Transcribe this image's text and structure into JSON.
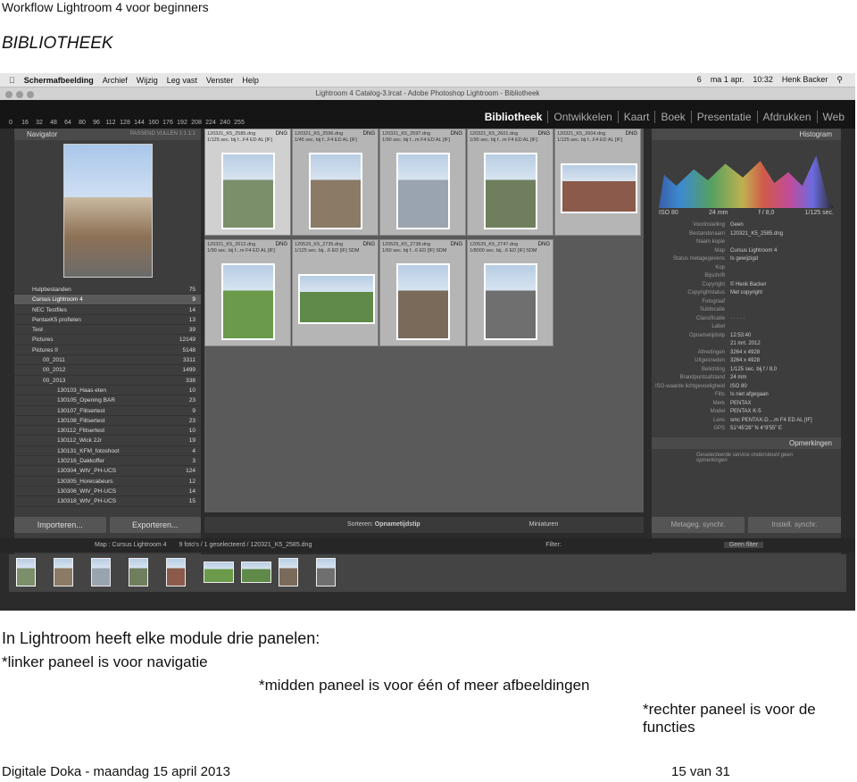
{
  "doc": {
    "title": "Workflow Lightroom 4 voor beginners",
    "section": "BIBLIOTHEEK"
  },
  "mac_menu": {
    "app": "Schermafbeelding",
    "items": [
      "Archief",
      "Wijzig",
      "Leg vast",
      "Venster",
      "Help"
    ],
    "status": [
      "6",
      "ma 1 apr.",
      "10:32",
      "Henk Backer"
    ]
  },
  "window_title": "Lightroom 4 Catalog-3.lrcat - Adobe Photoshop Lightroom - Bibliotheek",
  "thumb_sizes": [
    "0",
    "16",
    "32",
    "48",
    "64",
    "80",
    "96",
    "112",
    "128",
    "144",
    "160",
    "176",
    "192",
    "208",
    "224",
    "240",
    "255"
  ],
  "modules": [
    "Bibliotheek",
    "Ontwikkelen",
    "Kaart",
    "Boek",
    "Presentatie",
    "Afdrukken",
    "Web"
  ],
  "left_panel": {
    "navigator": "Navigator",
    "nav_opts": [
      "PASSEND",
      "VULLEN",
      "1:1",
      "1:1"
    ],
    "folders": [
      {
        "name": "Hulpbestanden",
        "count": "75"
      },
      {
        "name": "Cursus Lightroom 4",
        "count": "9"
      },
      {
        "name": "NEC Testfiles",
        "count": "14"
      },
      {
        "name": "PentaxK5 profielen",
        "count": "13"
      },
      {
        "name": "Test",
        "count": "39"
      },
      {
        "name": "Pictures",
        "count": "12149"
      },
      {
        "name": "Pictures II",
        "count": "5148"
      },
      {
        "name": "00_2011",
        "count": "3311"
      },
      {
        "name": "00_2012",
        "count": "1499"
      },
      {
        "name": "00_2013",
        "count": "338"
      },
      {
        "name": "130103_Haas eten",
        "count": "10"
      },
      {
        "name": "130105_Opening BAR",
        "count": "23"
      },
      {
        "name": "130107_Flitsertest",
        "count": "9"
      },
      {
        "name": "130108_Flitsertest",
        "count": "23"
      },
      {
        "name": "130112_Flitsertest",
        "count": "10"
      },
      {
        "name": "130112_Wick 2Jr",
        "count": "19"
      },
      {
        "name": "130131_KFM_fotoshoot",
        "count": "4"
      },
      {
        "name": "130216_Dakkoffer",
        "count": "3"
      },
      {
        "name": "130304_WtV_PH-UCS",
        "count": "124"
      },
      {
        "name": "130305_Horecabeurs",
        "count": "12"
      },
      {
        "name": "130306_WtV_PH-UCS",
        "count": "14"
      },
      {
        "name": "130318_WtV_PH-UCS",
        "count": "15"
      }
    ],
    "import": "Importeren...",
    "export": "Exporteren..."
  },
  "grid": {
    "cells": [
      {
        "file": "120321_K5_2585.dng",
        "meta": "1/125 sec. bij f...F4 ED AL [IF]",
        "type": "DNG",
        "shape": "portrait",
        "sel": true
      },
      {
        "file": "120321_K5_2596.dng",
        "meta": "1/45 sec. bij f...F4 ED AL [IF]",
        "type": "DNG",
        "shape": "portrait",
        "sel": false
      },
      {
        "file": "120321_K5_2597.dng",
        "meta": "1/90 sec. bij f...m F4 ED AL [IF]",
        "type": "DNG",
        "shape": "portrait",
        "sel": false
      },
      {
        "file": "120321_K5_2601.dng",
        "meta": "1/90 sec. bij f...m F4 ED AL [IF]",
        "type": "DNG",
        "shape": "portrait",
        "sel": false
      },
      {
        "file": "120321_K5_2604.dng",
        "meta": "1/125 sec. bij f...F4 ED AL [IF]",
        "type": "DNG",
        "shape": "landscape",
        "sel": false
      },
      {
        "file": "120321_K5_2612.dng",
        "meta": "1/90 sec. bij f...m F4 ED AL [IF]",
        "type": "DNG",
        "shape": "portrait",
        "sel": false
      },
      {
        "file": "120529_K5_2735.dng",
        "meta": "1/125 sec. bij...6 ED [IF] SDM",
        "type": "DNG",
        "shape": "landscape",
        "sel": false
      },
      {
        "file": "120529_K5_2738.dng",
        "meta": "1/60 sec. bij f...6 ED [IF] SDM",
        "type": "DNG",
        "shape": "portrait",
        "sel": false
      },
      {
        "file": "120529_K5_2747.dng",
        "meta": "1/8000 sec. bij...6 ED [IF] SDM",
        "type": "DNG",
        "shape": "portrait",
        "sel": false
      }
    ],
    "sort_label": "Sorteren:",
    "sort_value": "Opnametijdstip",
    "thumb_label": "Miniaturen"
  },
  "right_panel": {
    "histogram": "Histogram",
    "histo_info": [
      "ISO 80",
      "24 mm",
      "f / 8,0",
      "1/125 sec."
    ],
    "preset_label": "Voorinstelling",
    "preset_value": "Geen",
    "rows": [
      {
        "k": "Bestandsnaam",
        "v": "120321_K5_2585.dng"
      },
      {
        "k": "Naam kopie",
        "v": ""
      },
      {
        "k": "Map",
        "v": "Cursus Lightroom 4"
      },
      {
        "k": "Status metagegevens",
        "v": "Is gewijzigd"
      },
      {
        "k": "Kop",
        "v": ""
      },
      {
        "k": "Bijschrift",
        "v": ""
      },
      {
        "k": "Copyright",
        "v": "© Henk Backer"
      },
      {
        "k": "Copyrightstatus",
        "v": "Met copyright"
      },
      {
        "k": "Fotograaf",
        "v": ""
      },
      {
        "k": "Sublocatie",
        "v": ""
      },
      {
        "k": "Classificatie",
        "v": "· · · · ·"
      },
      {
        "k": "Label",
        "v": ""
      },
      {
        "k": "Opnametijdstip",
        "v": "12:53:40"
      },
      {
        "k": "",
        "v": "21 mrt. 2012"
      },
      {
        "k": "Afmetingen",
        "v": "3264 x 4928"
      },
      {
        "k": "Uitgesneden",
        "v": "3264 x 4928"
      },
      {
        "k": "Belichting",
        "v": "1/125 sec. bij f / 8,0"
      },
      {
        "k": "Brandpuntsafstand",
        "v": "24 mm"
      },
      {
        "k": "ISO-waarde lichtgevoeligheid",
        "v": "ISO 80"
      },
      {
        "k": "Flits",
        "v": "Is niet afgegaan"
      },
      {
        "k": "Merk",
        "v": "PENTAX"
      },
      {
        "k": "Model",
        "v": "PENTAX K-5"
      },
      {
        "k": "Lens",
        "v": "smc PENTAX-D....m F4 ED AL [IF]"
      },
      {
        "k": "GPS",
        "v": "51°45'28\" N 4°9'55\" E"
      }
    ],
    "comments": "Opmerkingen",
    "comments_note": "Geselecteerde service ondersteunt geen opmerkingen",
    "sync_meta": "Metageg. synchr.",
    "sync_settings": "Instell. synchr."
  },
  "filmstrip": {
    "path": "Map : Cursus Lightroom 4",
    "count": "9 foto's / 1 geselecteerd / 120321_K5_2585.dng",
    "filter_label": "Filter:",
    "filter_value": "Geen filter"
  },
  "captions": [
    "In Lightroom heeft elke module drie panelen:",
    "*linker paneel is voor navigatie",
    "*midden paneel is voor één of meer afbeeldingen",
    "*rechter paneel is voor de functies"
  ],
  "footer": {
    "left": "Digitale Doka - maandag 15 april 2013",
    "right": "15  van 31"
  }
}
